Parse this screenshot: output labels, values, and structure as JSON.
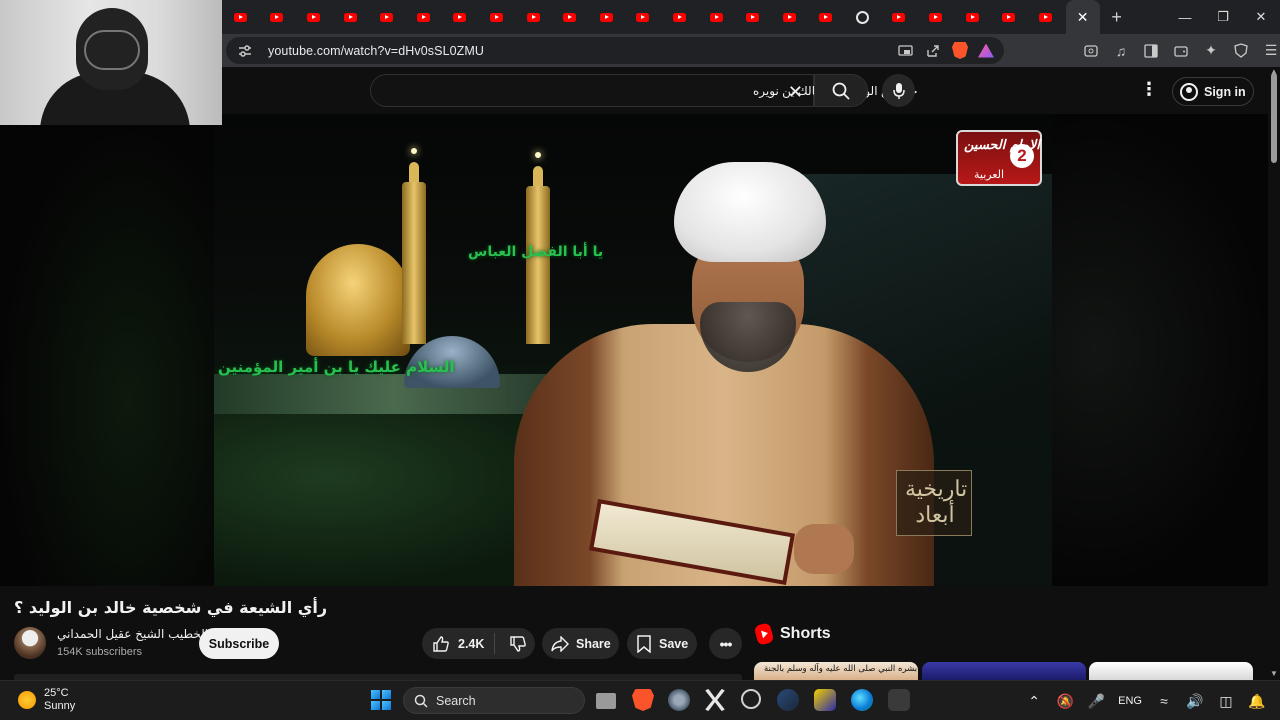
{
  "browser": {
    "url": "youtube.com/watch?v=dHv0sSL0ZMU",
    "brave_badge": "99+",
    "rewards_badge": "1",
    "tabs_count": 23,
    "window_controls": [
      "minimize",
      "restore",
      "close"
    ]
  },
  "youtube": {
    "search_query": "خالد بن الوليد، قتل مالك بن نويره",
    "signin_label": "Sign in",
    "video_title": "رأي الشيعة في شخصية خالد بن الوليد ؟",
    "channel_name": "الخطيب الشيخ عقيل الحمداني",
    "subscribers": "154K subscribers",
    "subscribe_label": "Subscribe",
    "like_count": "2.4K",
    "share_label": "Share",
    "save_label": "Save",
    "more_label": "•••",
    "shorts_label": "Shorts",
    "short1_caption": "بشره النبي صلى الله عليه وآله وسلم بالجنة"
  },
  "video_overlay": {
    "channel_logo_text": "الإمام الحسين",
    "channel_logo_number": "2",
    "channel_logo_sub": "العربية",
    "show_logo_text": "تاريخية أبعاد",
    "green_text_1": "السلام عليك يا بن أمير المؤمنين",
    "green_text_2": "يا أبا الفضل العباس"
  },
  "taskbar": {
    "temperature": "25°C",
    "weather": "Sunny",
    "search_placeholder": "Search",
    "language": "ENG"
  },
  "colors": {
    "youtube_red": "#ff0000",
    "background": "#0f0f0f",
    "chrome_dark": "#202124"
  }
}
